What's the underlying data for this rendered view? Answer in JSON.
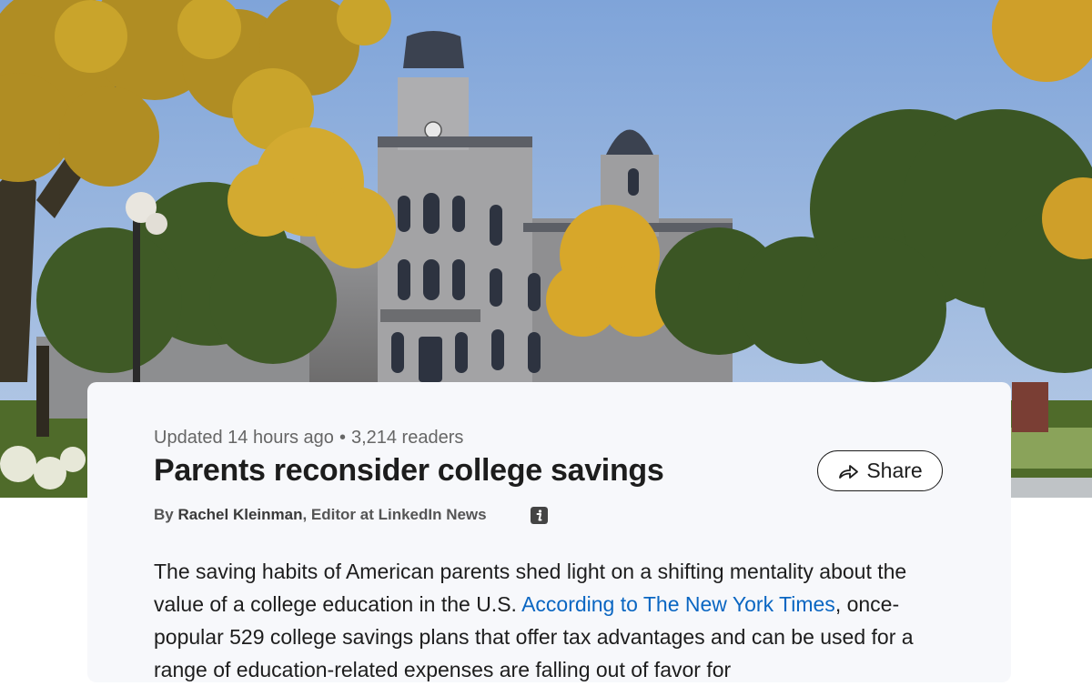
{
  "hero": {
    "image_description_icon": "campus-building-photo"
  },
  "article": {
    "updated": "Updated 14 hours ago",
    "separator": "•",
    "readers": "3,214 readers",
    "title": "Parents reconsider college savings",
    "byline_prefix": "By",
    "author": "Rachel Kleinman",
    "author_role": ", Editor at LinkedIn News",
    "share_label": "Share",
    "body_part1": "The saving habits of American parents shed light on a shifting mentality about the value of a college education in the U.S. ",
    "body_link": "According to The New York Times",
    "body_part2": ", once-popular 529 college savings plans that offer tax advantages and can be used for a range of education-related expenses are falling out of favor for"
  },
  "colors": {
    "link": "#0a66c2",
    "card_bg": "#f7f8fb",
    "text": "#1d1d1d"
  }
}
